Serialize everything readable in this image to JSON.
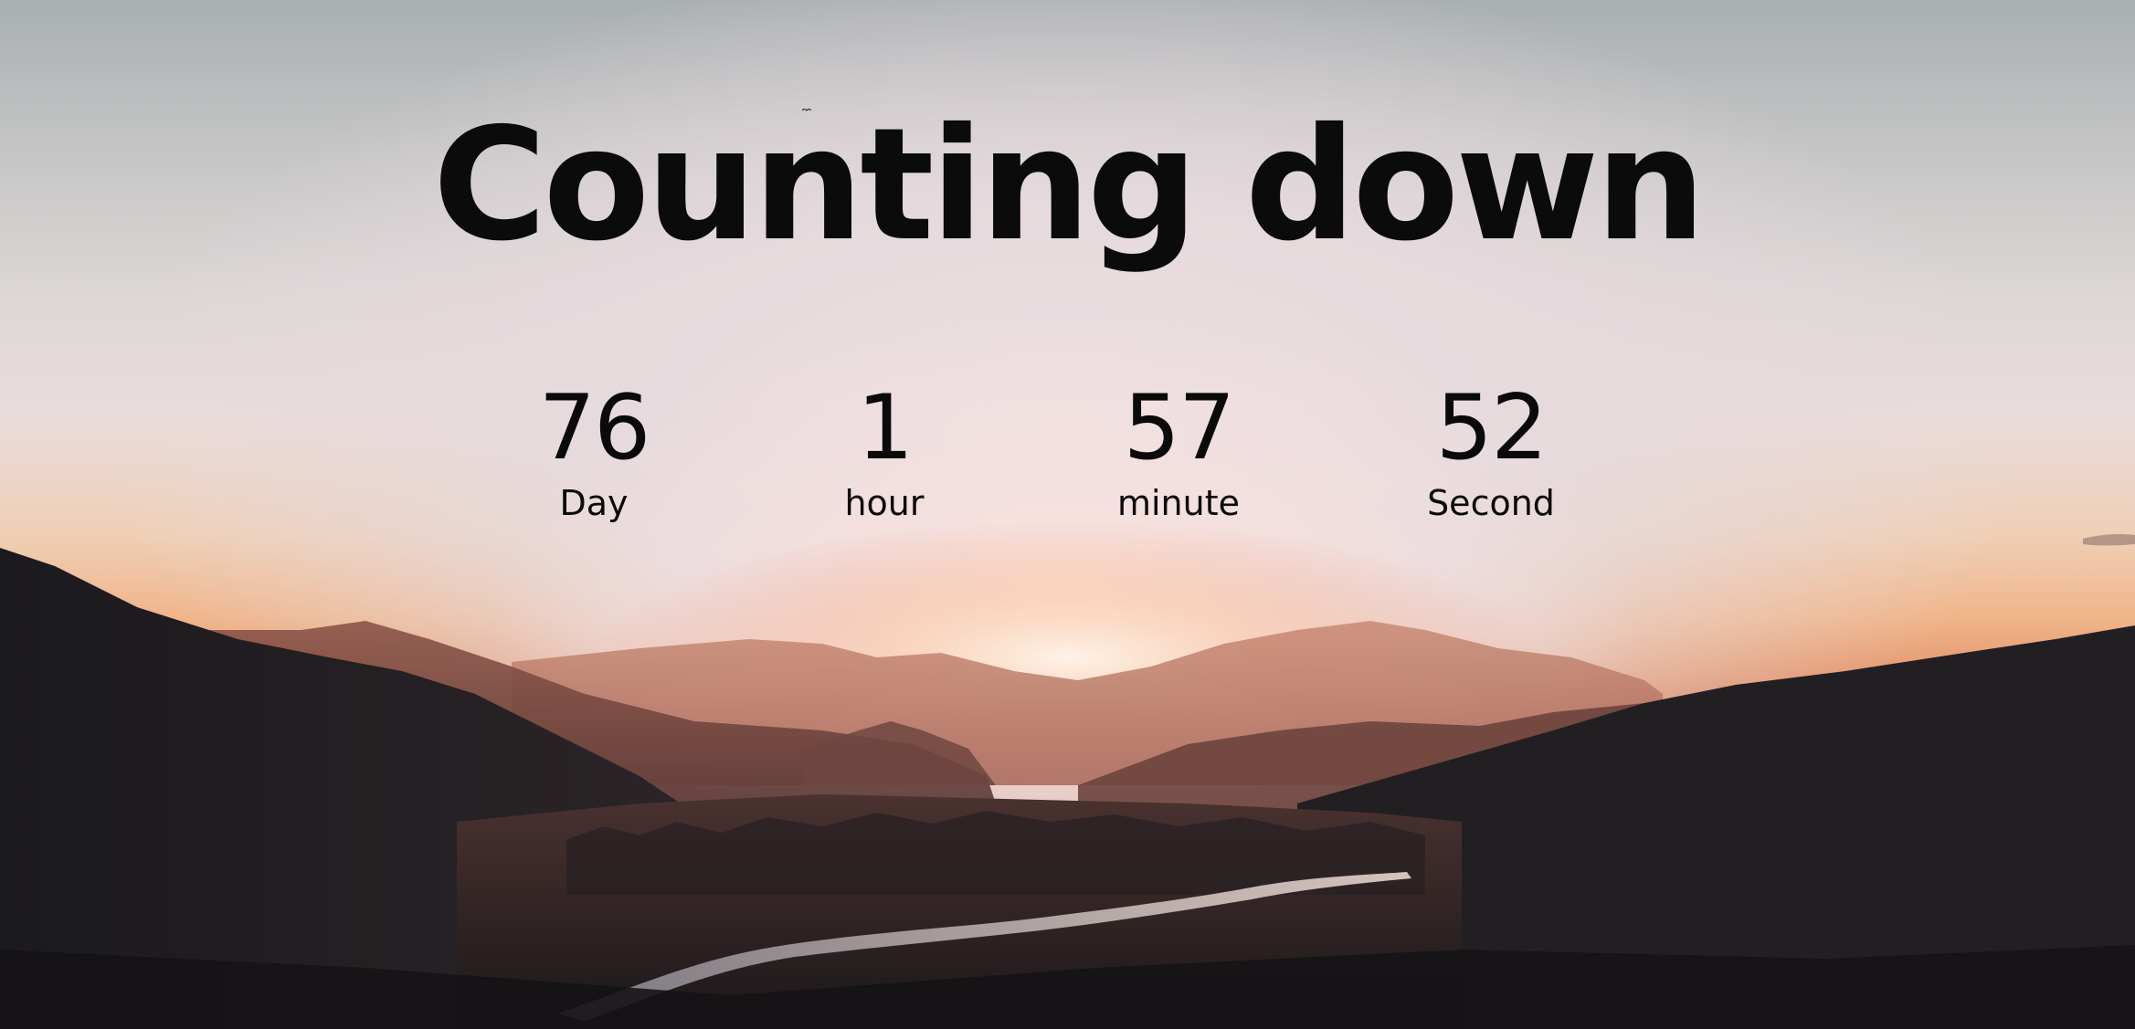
{
  "title": "Counting down",
  "countdown": {
    "day": {
      "value": "76",
      "label": "Day"
    },
    "hour": {
      "value": "1",
      "label": "hour"
    },
    "minute": {
      "value": "57",
      "label": "minute"
    },
    "second": {
      "value": "52",
      "label": "Second"
    }
  },
  "colors": {
    "text": "#0b0b0b",
    "sky_top": "#a9afb2",
    "glow": "#efcfb6",
    "mountain_dark": "#1d1b1e"
  }
}
